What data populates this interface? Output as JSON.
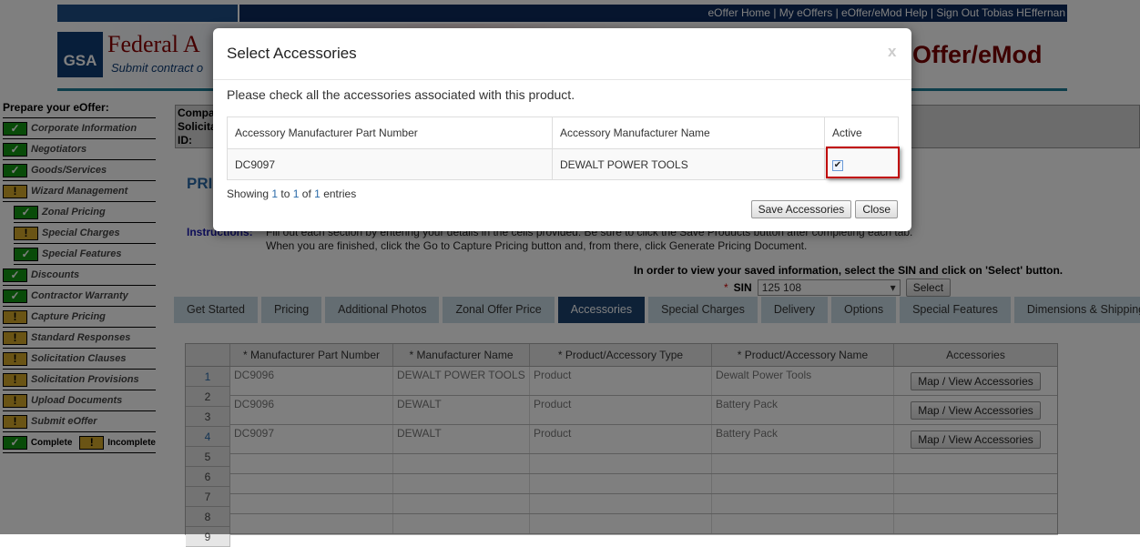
{
  "header": {
    "links": [
      "eOffer Home",
      "My eOffers",
      "eOffer/eMod Help",
      "Sign Out Tobias HEffernan"
    ],
    "logo": "GSA",
    "title": "Federal A",
    "subtitle": "Submit contract o",
    "app_name": "Offer/eMod"
  },
  "sidebar": {
    "heading": "Prepare your eOffer:",
    "items": [
      {
        "label": "Corporate Information",
        "status": "complete",
        "sub": false
      },
      {
        "label": "Negotiators",
        "status": "complete",
        "sub": false
      },
      {
        "label": "Goods/Services",
        "status": "complete",
        "sub": false
      },
      {
        "label": "Wizard Management",
        "status": "incomplete",
        "sub": false
      },
      {
        "label": "Zonal Pricing",
        "status": "complete",
        "sub": true
      },
      {
        "label": "Special Charges",
        "status": "incomplete",
        "sub": true
      },
      {
        "label": "Special Features",
        "status": "complete",
        "sub": true
      },
      {
        "label": "Discounts",
        "status": "complete",
        "sub": false
      },
      {
        "label": "Contractor Warranty",
        "status": "complete",
        "sub": false
      },
      {
        "label": "Capture Pricing",
        "status": "incomplete",
        "sub": false
      },
      {
        "label": "Standard Responses",
        "status": "incomplete",
        "sub": false
      },
      {
        "label": "Solicitation Clauses",
        "status": "incomplete",
        "sub": false
      },
      {
        "label": "Solicitation Provisions",
        "status": "incomplete",
        "sub": false
      },
      {
        "label": "Upload Documents",
        "status": "incomplete",
        "sub": false
      },
      {
        "label": "Submit eOffer",
        "status": "incomplete",
        "sub": false
      }
    ],
    "legend": {
      "complete": "Complete",
      "incomplete": "Incomplete"
    }
  },
  "company": {
    "lines": [
      "Compa",
      "Solicita",
      "ID:"
    ]
  },
  "page_title": "PRI",
  "instructions": {
    "label": "Instructions:",
    "line1": "Fill out each section by entering your details in the cells provided. Be sure to click the Save Products button after completing each tab.",
    "line2": "When you are finished, click the Go to Capture Pricing button and, from there, click Generate Pricing Document."
  },
  "sin": {
    "note": "In order to view your saved information, select the SIN and click on 'Select' button.",
    "label": "SIN",
    "value": "125 108",
    "button": "Select"
  },
  "tabs": [
    {
      "label": "Get Started"
    },
    {
      "label": "Pricing"
    },
    {
      "label": "Additional Photos"
    },
    {
      "label": "Zonal Offer Price"
    },
    {
      "label": "Accessories",
      "active": true
    },
    {
      "label": "Special Charges"
    },
    {
      "label": "Delivery"
    },
    {
      "label": "Options"
    },
    {
      "label": "Special Features"
    },
    {
      "label": "Dimensions & Shipping"
    }
  ],
  "grid": {
    "headers": [
      "* Manufacturer Part Number",
      "* Manufacturer Name",
      "* Product/Accessory Type",
      "* Product/Accessory Name",
      "Accessories"
    ],
    "row_numbers": [
      "1",
      "2",
      "3",
      "4",
      "5",
      "6",
      "7",
      "8",
      "9"
    ],
    "rows": [
      {
        "part": "DC9096",
        "mfr": "DEWALT POWER TOOLS",
        "type": "Product",
        "name": "Dewalt Power Tools",
        "action": "Map / View Accessories"
      },
      {
        "part": "DC9096",
        "mfr": "DEWALT",
        "type": "Product",
        "name": "Battery Pack",
        "action": "Map / View Accessories"
      },
      {
        "part": "DC9097",
        "mfr": "DEWALT",
        "type": "Product",
        "name": "Battery Pack",
        "action": "Map / View Accessories"
      }
    ]
  },
  "modal": {
    "title": "Select Accessories",
    "close_x": "x",
    "text": "Please check all the accessories associated with this product.",
    "headers": [
      "Accessory Manufacturer Part Number",
      "Accessory Manufacturer Name",
      "Active"
    ],
    "rows": [
      {
        "part": "DC9097",
        "name": "DEWALT POWER TOOLS",
        "active": true
      }
    ],
    "showing": {
      "prefix": "Showing",
      "from": "1",
      "to_word": "to",
      "to": "1",
      "of_word": "of",
      "total": "1",
      "suffix": "entries"
    },
    "save": "Save Accessories",
    "close": "Close"
  }
}
